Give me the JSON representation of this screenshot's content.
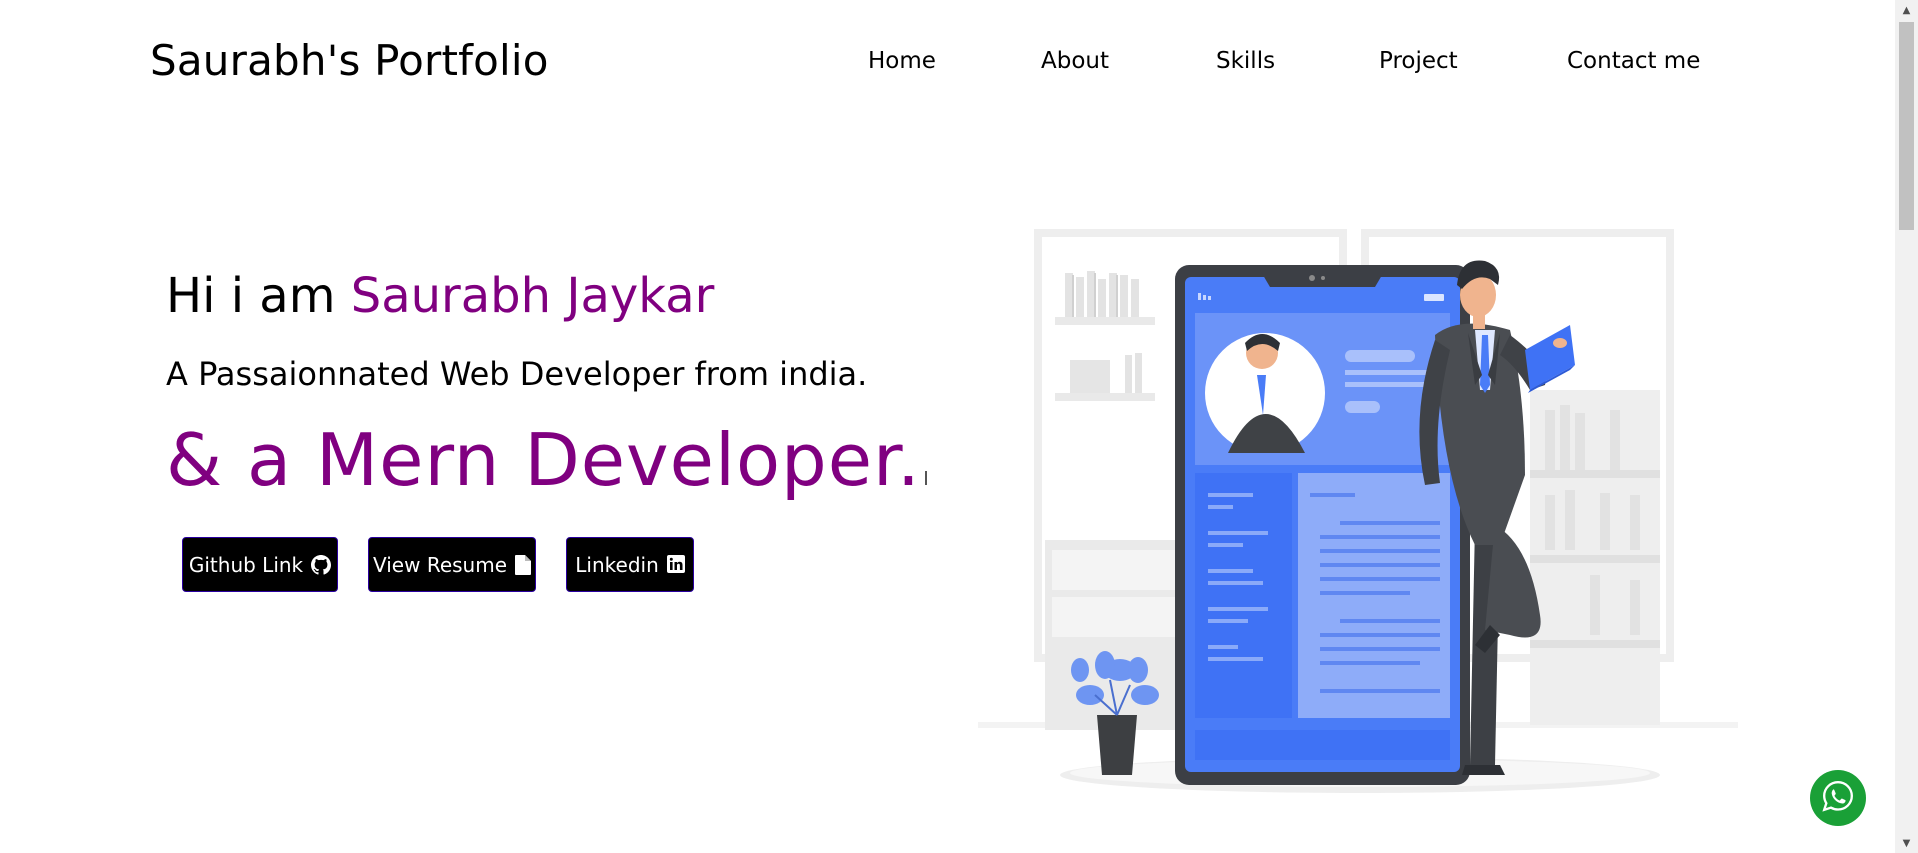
{
  "navbar": {
    "brand": "Saurabh's Portfolio",
    "links": [
      "Home",
      "About",
      "Skills",
      "Project",
      "Contact me"
    ]
  },
  "hero": {
    "greeting_prefix": "Hi i am",
    "name": "Saurabh Jaykar",
    "subtitle": "A Passaionnated Web Developer from india.",
    "typed_text": "& a Mern Developer."
  },
  "buttons": {
    "github": "Github Link",
    "resume": "View Resume",
    "linkedin": "Linkedin"
  },
  "icons": {
    "github": "github-icon",
    "resume": "file-icon",
    "linkedin": "linkedin-icon",
    "whatsapp": "whatsapp-icon"
  },
  "colors": {
    "accent": "#800080",
    "button_bg": "#000000",
    "button_border": "#2a00a0",
    "illustration_blue": "#4a7cf7",
    "whatsapp_green": "#1aa037"
  }
}
